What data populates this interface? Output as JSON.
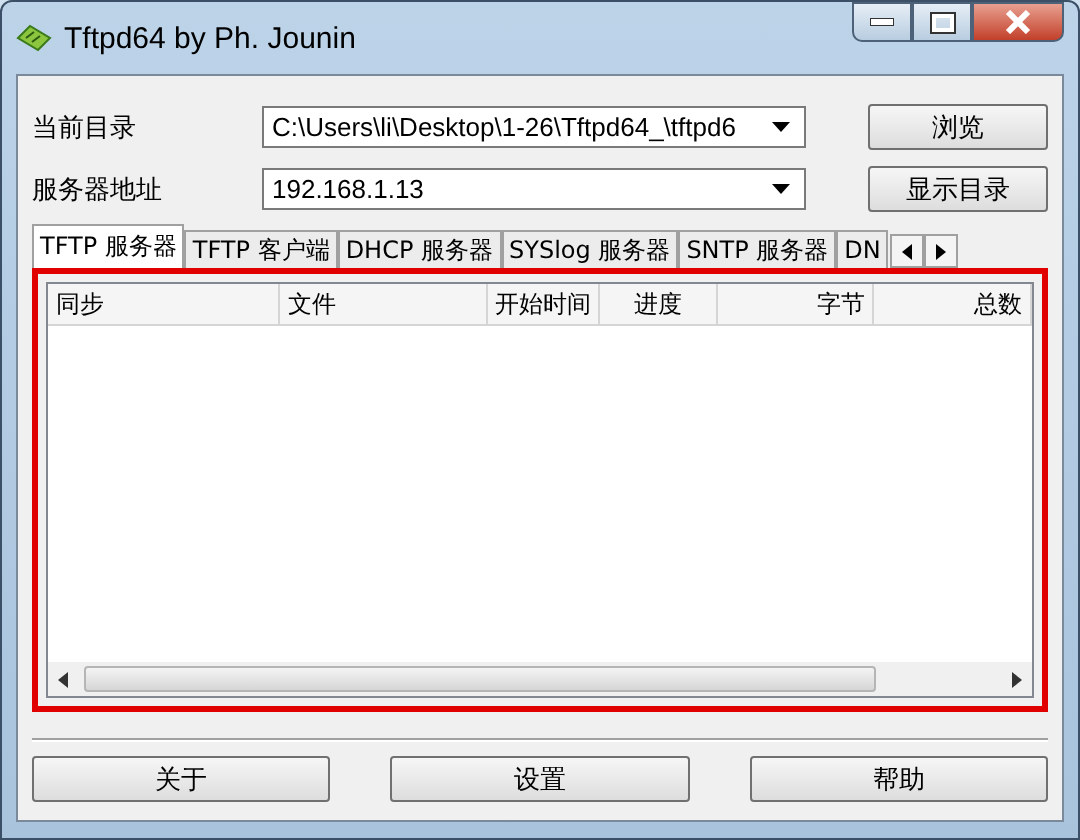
{
  "window": {
    "title": "Tftpd64 by Ph. Jounin"
  },
  "fields": [
    {
      "label": "当前目录",
      "value": "C:\\Users\\li\\Desktop\\1-26\\Tftpd64_\\tftpd6",
      "button": "浏览"
    },
    {
      "label": "服务器地址",
      "value": "192.168.1.13",
      "button": "显示目录"
    }
  ],
  "tabs": [
    {
      "label": "TFTP 服务器",
      "selected": true
    },
    {
      "label": "TFTP 客户端",
      "selected": false
    },
    {
      "label": "DHCP 服务器",
      "selected": false
    },
    {
      "label": "SYSlog 服务器",
      "selected": false
    },
    {
      "label": "SNTP 服务器",
      "selected": false
    },
    {
      "label": "DN",
      "selected": false
    }
  ],
  "table": {
    "columns": [
      "同步",
      "文件",
      "开始时间",
      "进度",
      "字节",
      "总数"
    ]
  },
  "buttons": [
    "关于",
    "设置",
    "帮助"
  ]
}
